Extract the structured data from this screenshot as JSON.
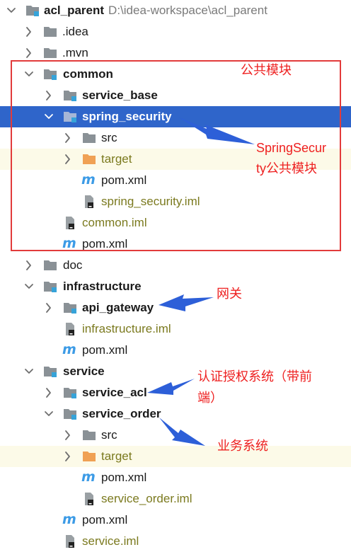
{
  "rows": [
    {
      "label": "acl_parent",
      "path": "D:\\idea-workspace\\acl_parent",
      "icon": "module-folder-icon",
      "arrow": "down",
      "bold": true
    },
    {
      "label": ".idea",
      "icon": "folder-icon",
      "arrow": "right"
    },
    {
      "label": ".mvn",
      "icon": "folder-icon",
      "arrow": "right"
    },
    {
      "label": "common",
      "icon": "module-folder-icon",
      "arrow": "down",
      "bold": true
    },
    {
      "label": "service_base",
      "icon": "module-folder-icon",
      "arrow": "right",
      "bold": true
    },
    {
      "label": "spring_security",
      "icon": "module-folder-icon",
      "arrow": "down",
      "bold": true,
      "selected": true
    },
    {
      "label": "src",
      "icon": "folder-icon",
      "arrow": "right"
    },
    {
      "label": "target",
      "icon": "orange-folder-icon",
      "arrow": "right",
      "olive": true,
      "excluded": true
    },
    {
      "label": "pom.xml",
      "icon": "maven-icon"
    },
    {
      "label": "spring_security.iml",
      "icon": "iml-file-icon",
      "olive": true
    },
    {
      "label": "common.iml",
      "icon": "iml-file-icon",
      "olive": true
    },
    {
      "label": "pom.xml",
      "icon": "maven-icon"
    },
    {
      "label": "doc",
      "icon": "folder-icon",
      "arrow": "right"
    },
    {
      "label": "infrastructure",
      "icon": "module-folder-icon",
      "arrow": "down",
      "bold": true
    },
    {
      "label": "api_gateway",
      "icon": "module-folder-icon",
      "arrow": "right",
      "bold": true
    },
    {
      "label": "infrastructure.iml",
      "icon": "iml-file-icon",
      "olive": true
    },
    {
      "label": "pom.xml",
      "icon": "maven-icon"
    },
    {
      "label": "service",
      "icon": "module-folder-icon",
      "arrow": "down",
      "bold": true
    },
    {
      "label": "service_acl",
      "icon": "module-folder-icon",
      "arrow": "right",
      "bold": true
    },
    {
      "label": "service_order",
      "icon": "module-folder-icon",
      "arrow": "down",
      "bold": true
    },
    {
      "label": "src",
      "icon": "folder-icon",
      "arrow": "right"
    },
    {
      "label": "target",
      "icon": "orange-folder-icon",
      "arrow": "right",
      "olive": true,
      "excluded": true
    },
    {
      "label": "pom.xml",
      "icon": "maven-icon"
    },
    {
      "label": "service_order.iml",
      "icon": "iml-file-icon",
      "olive": true
    },
    {
      "label": "pom.xml",
      "icon": "maven-icon"
    },
    {
      "label": "service.iml",
      "icon": "iml-file-icon",
      "olive": true
    }
  ],
  "annotations": {
    "common": "公共模块",
    "spring_security_line1": "SpringSecur",
    "spring_security_line2": "ty公共模块",
    "gateway": "网关",
    "auth_line1": "认证授权系统（带前",
    "auth_line2": "端）",
    "business": "业务系统"
  },
  "colors": {
    "selection": "#2f65ca",
    "annotation_red": "#e23b3b",
    "arrow_blue": "#2d5fd8",
    "excluded_bg": "#fcfae8",
    "iml_text": "#7b7a1f"
  }
}
